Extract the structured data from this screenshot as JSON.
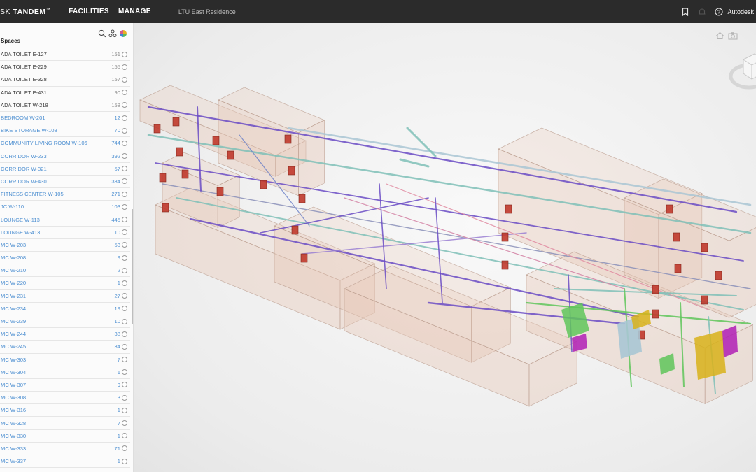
{
  "header": {
    "brand_prefix": "SK",
    "brand_name": "TANDEM",
    "brand_mark": "™",
    "nav": [
      "FACILITIES",
      "MANAGE"
    ],
    "facility": "LTU East Residence",
    "user": "Autodesk"
  },
  "panel": {
    "title": "Spaces",
    "rows": [
      {
        "name": "ADA TOILET E-127",
        "count": "151",
        "style": "dark"
      },
      {
        "name": "ADA TOILET E-229",
        "count": "155",
        "style": "dark"
      },
      {
        "name": "ADA TOILET E-328",
        "count": "157",
        "style": "dark"
      },
      {
        "name": "ADA TOILET E-431",
        "count": "90",
        "style": "dark"
      },
      {
        "name": "ADA TOILET W-218",
        "count": "158",
        "style": "dark"
      },
      {
        "name": "BEDROOM W-201",
        "count": "12",
        "style": "link"
      },
      {
        "name": "BIKE STORAGE W-108",
        "count": "70",
        "style": "link"
      },
      {
        "name": "COMMUNITY LIVING ROOM W-106",
        "count": "744",
        "style": "link"
      },
      {
        "name": "CORRIDOR W-233",
        "count": "392",
        "style": "link"
      },
      {
        "name": "CORRIDOR W-321",
        "count": "57",
        "style": "link"
      },
      {
        "name": "CORRIDOR W-430",
        "count": "334",
        "style": "link"
      },
      {
        "name": "FITNESS CENTER W-105",
        "count": "271",
        "style": "link"
      },
      {
        "name": "JC W-110",
        "count": "103",
        "style": "link"
      },
      {
        "name": "LOUNGE W-113",
        "count": "445",
        "style": "link"
      },
      {
        "name": "LOUNGE W-413",
        "count": "10",
        "style": "link"
      },
      {
        "name": "MC W-203",
        "count": "53",
        "style": "link"
      },
      {
        "name": "MC W-208",
        "count": "9",
        "style": "link"
      },
      {
        "name": "MC W-210",
        "count": "2",
        "style": "link"
      },
      {
        "name": "MC W-220",
        "count": "1",
        "style": "link"
      },
      {
        "name": "MC W-231",
        "count": "27",
        "style": "link"
      },
      {
        "name": "MC W-234",
        "count": "19",
        "style": "link"
      },
      {
        "name": "MC W-239",
        "count": "10",
        "style": "link"
      },
      {
        "name": "MC W-244",
        "count": "38",
        "style": "link"
      },
      {
        "name": "MC W-245",
        "count": "34",
        "style": "link"
      },
      {
        "name": "MC W-303",
        "count": "7",
        "style": "link"
      },
      {
        "name": "MC W-304",
        "count": "1",
        "style": "link"
      },
      {
        "name": "MC W-307",
        "count": "9",
        "style": "link"
      },
      {
        "name": "MC W-308",
        "count": "3",
        "style": "link"
      },
      {
        "name": "MC W-316",
        "count": "1",
        "style": "link"
      },
      {
        "name": "MC W-328",
        "count": "7",
        "style": "link"
      },
      {
        "name": "MC W-330",
        "count": "1",
        "style": "link"
      },
      {
        "name": "MC W-333",
        "count": "71",
        "style": "link"
      },
      {
        "name": "MC W-337",
        "count": "1",
        "style": "link"
      }
    ]
  },
  "icons": {
    "search": "search-icon",
    "hierarchy": "hierarchy-icon",
    "color": "color-wheel-icon",
    "bookmark": "bookmark-icon",
    "bell": "bell-icon",
    "help": "help-icon",
    "home": "home-icon",
    "camera": "camera-icon"
  },
  "colors": {
    "topbar": "#2b2b2b",
    "link": "#4d8fd1",
    "duct_purple": "#6a4bc4",
    "pipe_teal": "#7fbfb7",
    "equipment_red": "#c0392b",
    "pipe_green": "#5fc65a",
    "equipment_yellow": "#d8b21a",
    "equipment_magenta": "#b01fb5",
    "shell": "#e8c8b8"
  }
}
